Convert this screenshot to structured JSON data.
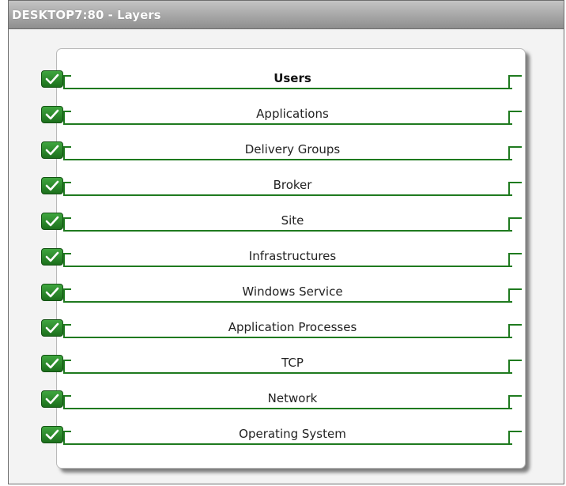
{
  "window": {
    "title": "DESKTOP7:80  - Layers"
  },
  "layers": [
    {
      "label": "Users",
      "bold": true
    },
    {
      "label": "Applications"
    },
    {
      "label": "Delivery Groups"
    },
    {
      "label": "Broker"
    },
    {
      "label": "Site"
    },
    {
      "label": "Infrastructures"
    },
    {
      "label": "Windows Service"
    },
    {
      "label": "Application Processes"
    },
    {
      "label": "TCP"
    },
    {
      "label": "Network"
    },
    {
      "label": "Operating System"
    }
  ],
  "colors": {
    "accent": "#1f7a1f",
    "titlebar": "#a6a6a6"
  },
  "icons": {
    "status": "checkmark-icon"
  }
}
